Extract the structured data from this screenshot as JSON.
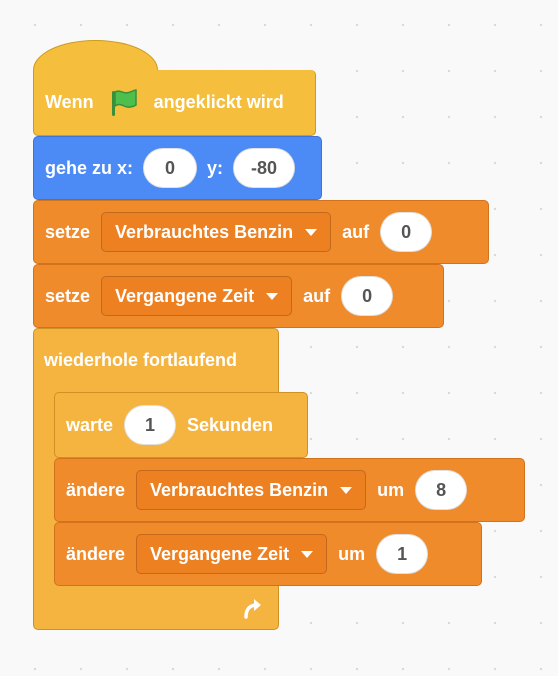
{
  "script": {
    "when_flag": {
      "prefix": "Wenn",
      "suffix": "angeklickt wird",
      "flag_icon": "green-flag-icon"
    },
    "goto": {
      "label": "gehe zu x:",
      "x_value": "0",
      "y_label": "y:",
      "y_value": "-80"
    },
    "set_fuel": {
      "label": "setze",
      "variable": "Verbrauchtes Benzin",
      "to_label": "auf",
      "value": "0"
    },
    "set_time": {
      "label": "setze",
      "variable": "Vergangene Zeit",
      "to_label": "auf",
      "value": "0"
    },
    "forever": {
      "label": "wiederhole fortlaufend",
      "loop_icon": "loop-arrow-icon"
    },
    "wait": {
      "label": "warte",
      "value": "1",
      "unit": "Sekunden"
    },
    "change_fuel": {
      "label": "ändere",
      "variable": "Verbrauchtes Benzin",
      "by_label": "um",
      "value": "8"
    },
    "change_time": {
      "label": "ändere",
      "variable": "Vergangene Zeit",
      "by_label": "um",
      "value": "1"
    }
  },
  "colors": {
    "events": "#f5be3d",
    "motion": "#4c8bf5",
    "variables": "#f08b2c",
    "control": "#f5b440"
  }
}
